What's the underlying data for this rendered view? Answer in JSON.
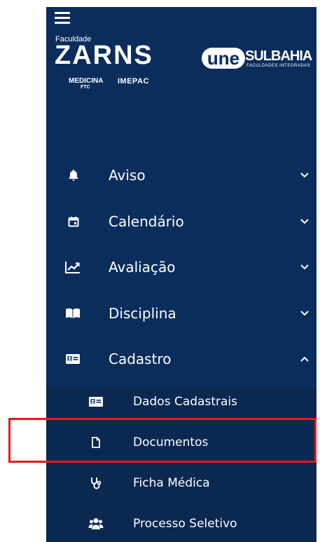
{
  "logos": {
    "faculdade": "Faculdade",
    "zarns": "ZARNS",
    "une": "une",
    "sulbahia": "SULBAHIA",
    "sulbahia_sub": "FACULDADES INTEGRADAS",
    "medicina": "MEDICINA",
    "ftc": "FTC",
    "imepac": "IMEPAC"
  },
  "menu": [
    {
      "label": "Aviso",
      "icon": "bell-icon",
      "chevron": "chevron-down-icon"
    },
    {
      "label": "Calendário",
      "icon": "calendar-icon",
      "chevron": "chevron-down-icon"
    },
    {
      "label": "Avaliação",
      "icon": "chart-line-icon",
      "chevron": "chevron-down-icon"
    },
    {
      "label": "Disciplina",
      "icon": "book-open-icon",
      "chevron": "chevron-down-icon"
    },
    {
      "label": "Cadastro",
      "icon": "id-card-icon",
      "chevron": "chevron-up-icon"
    }
  ],
  "submenu": [
    {
      "label": "Dados Cadastrais",
      "icon": "id-card-icon"
    },
    {
      "label": "Documentos",
      "icon": "file-icon"
    },
    {
      "label": "Ficha Médica",
      "icon": "stethoscope-icon"
    },
    {
      "label": "Processo Seletivo",
      "icon": "users-icon"
    }
  ],
  "colors": {
    "sidebar_bg": "#0b2d5c",
    "highlight": "#e31b1b"
  }
}
